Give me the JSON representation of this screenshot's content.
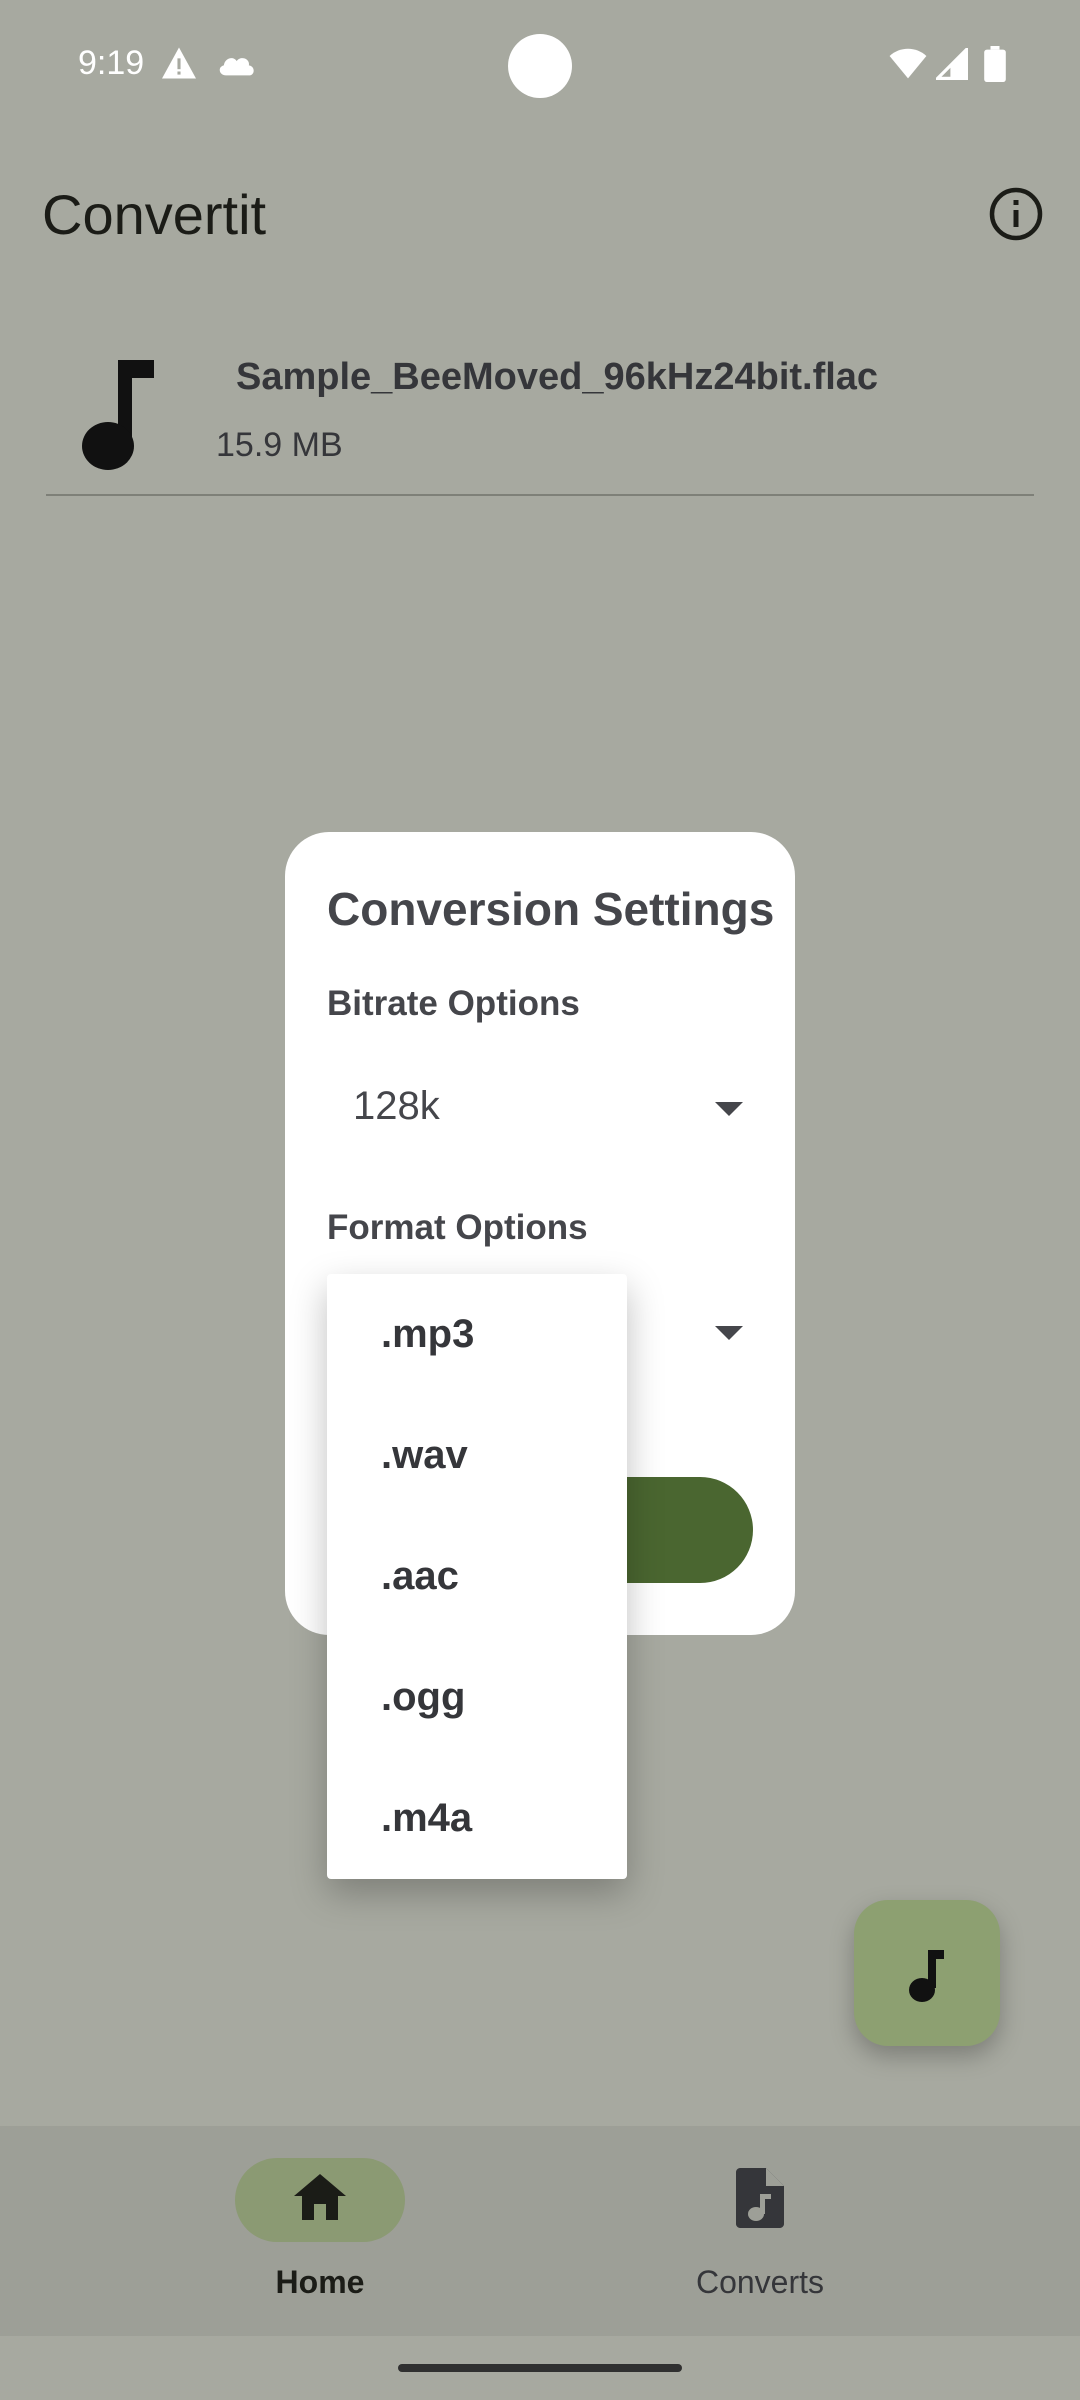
{
  "status_bar": {
    "time": "9:19",
    "left_icons": [
      "warning-icon",
      "cloud-icon"
    ],
    "right_icons": [
      "wifi-icon",
      "signal-icon",
      "battery-icon"
    ]
  },
  "app_bar": {
    "title": "Convertit",
    "action_icon": "info-icon"
  },
  "file": {
    "icon": "music-note-icon",
    "name": "Sample_BeeMoved_96kHz24bit.flac",
    "size": "15.9 MB"
  },
  "dialog": {
    "title": "Conversion Settings",
    "bitrate_label": "Bitrate Options",
    "bitrate_value": "128k",
    "format_label": "Format Options",
    "format_value": "",
    "button_color": "#4a6630"
  },
  "format_menu": {
    "items": [
      ".mp3",
      ".wav",
      ".aac",
      ".ogg",
      ".m4a"
    ]
  },
  "fab": {
    "icon": "music-note-icon",
    "color": "#8da071"
  },
  "bottom_nav": {
    "items": [
      {
        "label": "Home",
        "icon": "home-icon",
        "selected": true
      },
      {
        "label": "Converts",
        "icon": "audio-file-icon",
        "selected": false
      }
    ]
  },
  "colors": {
    "scrim_background": "#a7a9a0",
    "accent": "#4a6630",
    "nav_indicator": "#8b9a73"
  }
}
